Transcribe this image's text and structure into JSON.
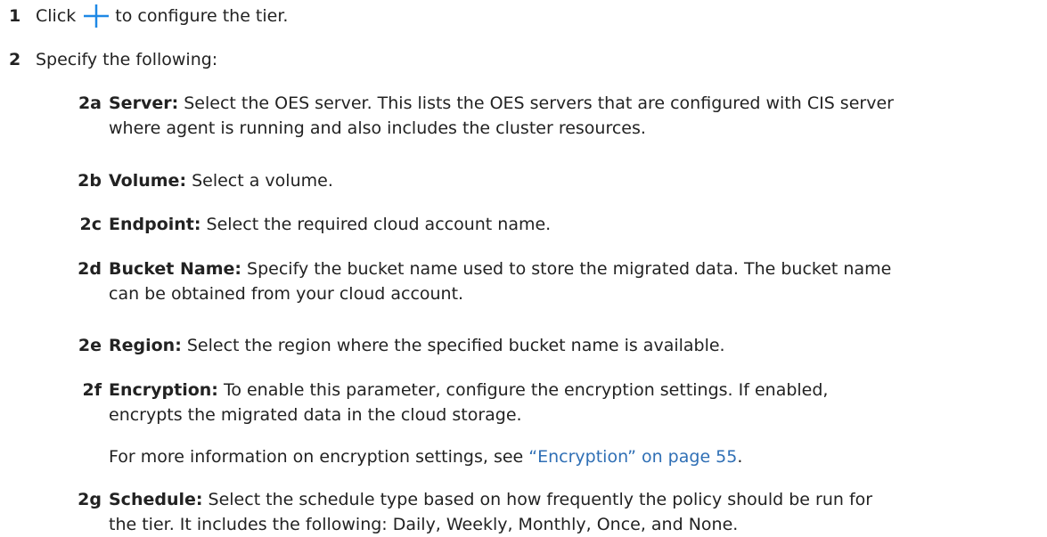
{
  "steps": [
    {
      "num": "1",
      "pre": "Click",
      "post": "to configure the tier.",
      "icon": "plus-icon"
    },
    {
      "num": "2",
      "text": "Specify the following:"
    }
  ],
  "substeps": {
    "a": {
      "num": "2a",
      "term": "Server:",
      "line1": "Select the OES server. This lists the OES servers that are configured with CIS server",
      "line2": "where agent is running and also includes the cluster resources."
    },
    "b": {
      "num": "2b",
      "term": "Volume:",
      "line1": "Select a volume."
    },
    "c": {
      "num": "2c",
      "term": "Endpoint:",
      "line1": "Select the required cloud account name."
    },
    "d": {
      "num": "2d",
      "term": "Bucket Name:",
      "line1": "Specify the bucket name used to store the migrated data. The bucket name",
      "line2": "can be obtained from your cloud account."
    },
    "e": {
      "num": "2e",
      "term": "Region:",
      "line1": "Select the region where the specified bucket name is available."
    },
    "f": {
      "num": "2f",
      "term": "Encryption:",
      "line1": "To enable this parameter, configure the encryption settings. If enabled,",
      "line2": "encrypts the migrated data in the cloud storage."
    },
    "g": {
      "num": "2g",
      "term": "Schedule:",
      "line1": "Select the schedule type based on how frequently the policy should be run for",
      "line2": "the tier. It includes the following: Daily, Weekly, Monthly, Once, and None."
    }
  },
  "note": {
    "pre": "For more information on encryption settings, see ",
    "link": "“Encryption” on page 55",
    "post": "."
  },
  "colors": {
    "text": "#222222",
    "link": "#2f6fb5",
    "icon": "#1e88e5"
  }
}
